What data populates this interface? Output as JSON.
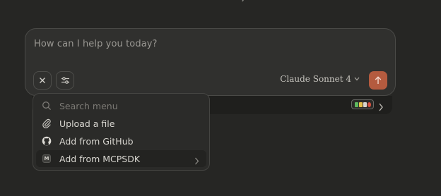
{
  "composer": {
    "placeholder": "How can I help you today?",
    "model_name": "Claude Sonnet 4"
  },
  "attach_menu": {
    "search_placeholder": "Search menu",
    "items": [
      {
        "label": "Upload a file",
        "icon": "paperclip-icon"
      },
      {
        "label": "Add from GitHub",
        "icon": "github-icon"
      },
      {
        "label": "Add from MCPSDK",
        "icon": "mcp-icon",
        "badge": "M",
        "has_submenu": true,
        "highlighted": true
      }
    ]
  },
  "colors": {
    "background": "#262624",
    "composer": "#30302e",
    "send_button": "#b45b3f",
    "menu": "#2b2b29",
    "connector_chips": [
      "#5fb85f",
      "#e8c14a",
      "#d9d6cf",
      "#d8503e"
    ]
  }
}
